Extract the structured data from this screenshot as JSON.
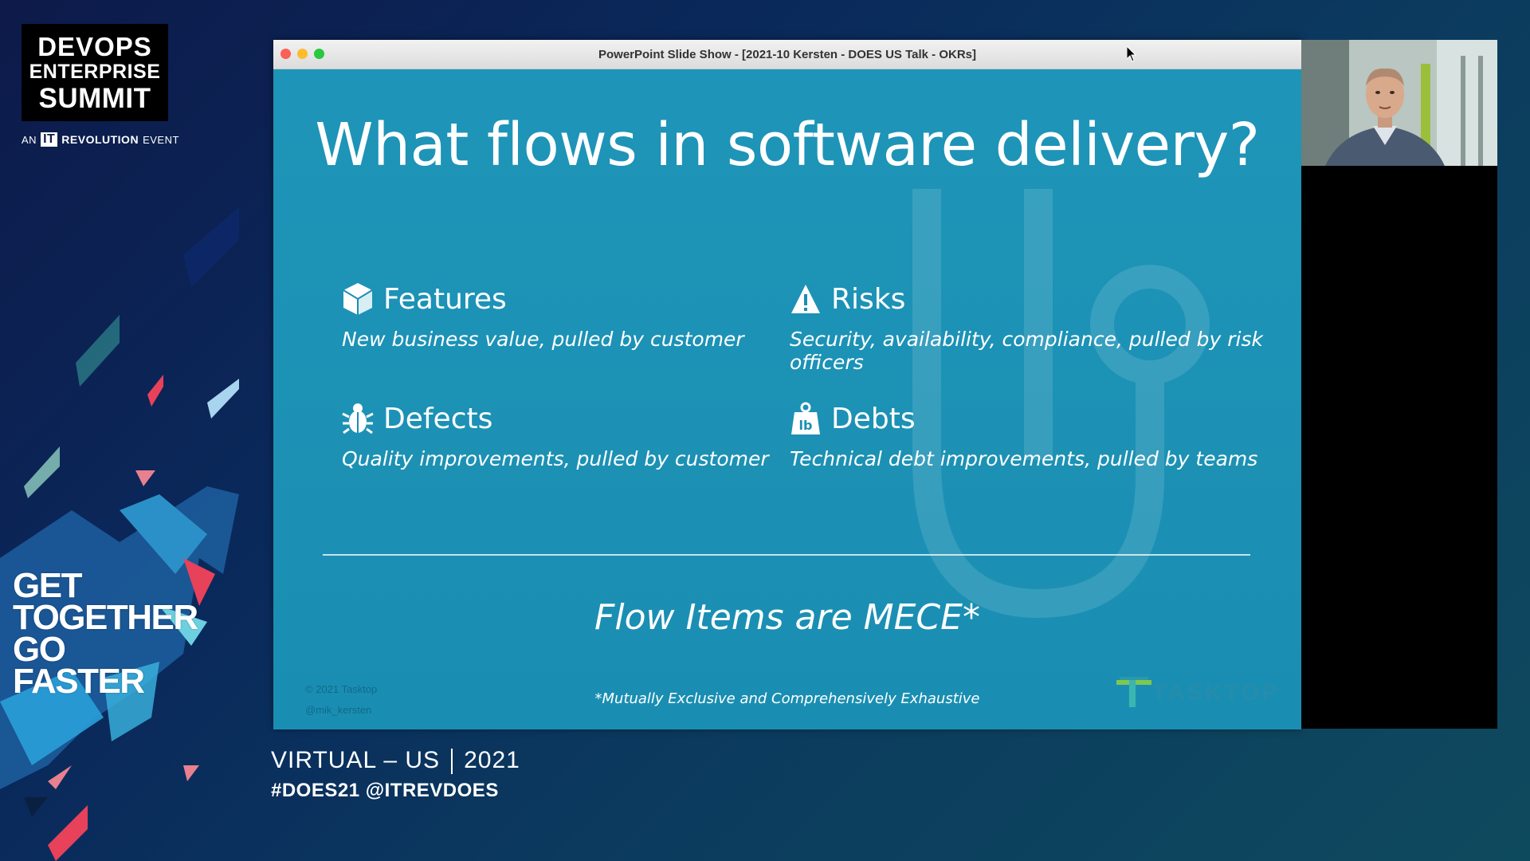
{
  "branding": {
    "logo_line1": "DEVOPS",
    "logo_line2": "ENTERPRISE",
    "logo_line3": "SUMMIT",
    "an": "AN",
    "it": "IT",
    "revolution": "REVOLUTION",
    "event": "EVENT",
    "tagline": [
      "GET",
      "TOGETHER",
      "GO",
      "FASTER"
    ]
  },
  "footer": {
    "virtual": "VIRTUAL – US",
    "year": "2021",
    "hashtags": "#DOES21 @ITREVDOES"
  },
  "window": {
    "title": "PowerPoint Slide Show - [2021-10 Kersten - DOES US Talk - OKRs]"
  },
  "slide": {
    "title": "What flows in software delivery?",
    "flows": [
      {
        "icon": "box-icon",
        "name": "Features",
        "desc": "New business value, pulled by customer"
      },
      {
        "icon": "warning-icon",
        "name": "Risks",
        "desc": "Security, availability, compliance, pulled by risk officers"
      },
      {
        "icon": "bug-icon",
        "name": "Defects",
        "desc": "Quality improvements, pulled by customer"
      },
      {
        "icon": "weight-icon",
        "name": "Debts",
        "desc": "Technical debt improvements, pulled by teams"
      }
    ],
    "mece": "Flow Items are MECE*",
    "footnote": "*Mutually Exclusive and Comprehensively Exhaustive",
    "copyright": "© 2021 Tasktop",
    "handle": "@mik_kersten",
    "brand": "TASKTOP"
  },
  "colors": {
    "slide_bg": "#1e95b8",
    "accent_red": "#e8415a",
    "accent_teal": "#3ab5b0"
  }
}
